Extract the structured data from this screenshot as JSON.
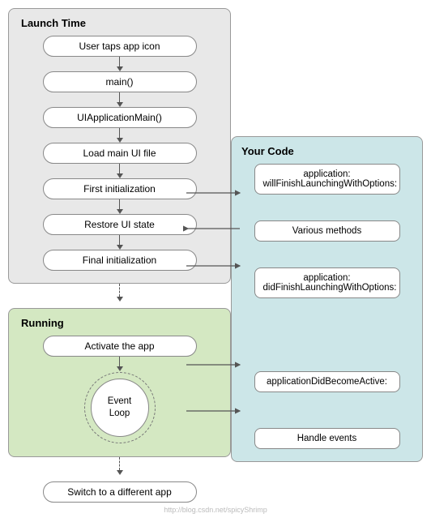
{
  "diagram": {
    "launchTime": {
      "label": "Launch Time",
      "nodes": [
        "User taps app icon",
        "main()",
        "UIApplicationMain()",
        "Load main UI file",
        "First initialization",
        "Restore UI state",
        "Final initialization"
      ]
    },
    "running": {
      "label": "Running",
      "nodes": [
        "Activate the app",
        "Event\nLoop"
      ]
    },
    "bottomNode": "Switch to a different app",
    "yourCode": {
      "label": "Your Code",
      "nodes": [
        "application:\nwillFinishLaunchingWithOptions:",
        "Various methods",
        "application:\ndidFinishLaunchingWithOptions:",
        "applicationDidBecomeActive:",
        "Handle events"
      ]
    },
    "watermark": "http://blog.csdn.net/spicyShrimp"
  }
}
